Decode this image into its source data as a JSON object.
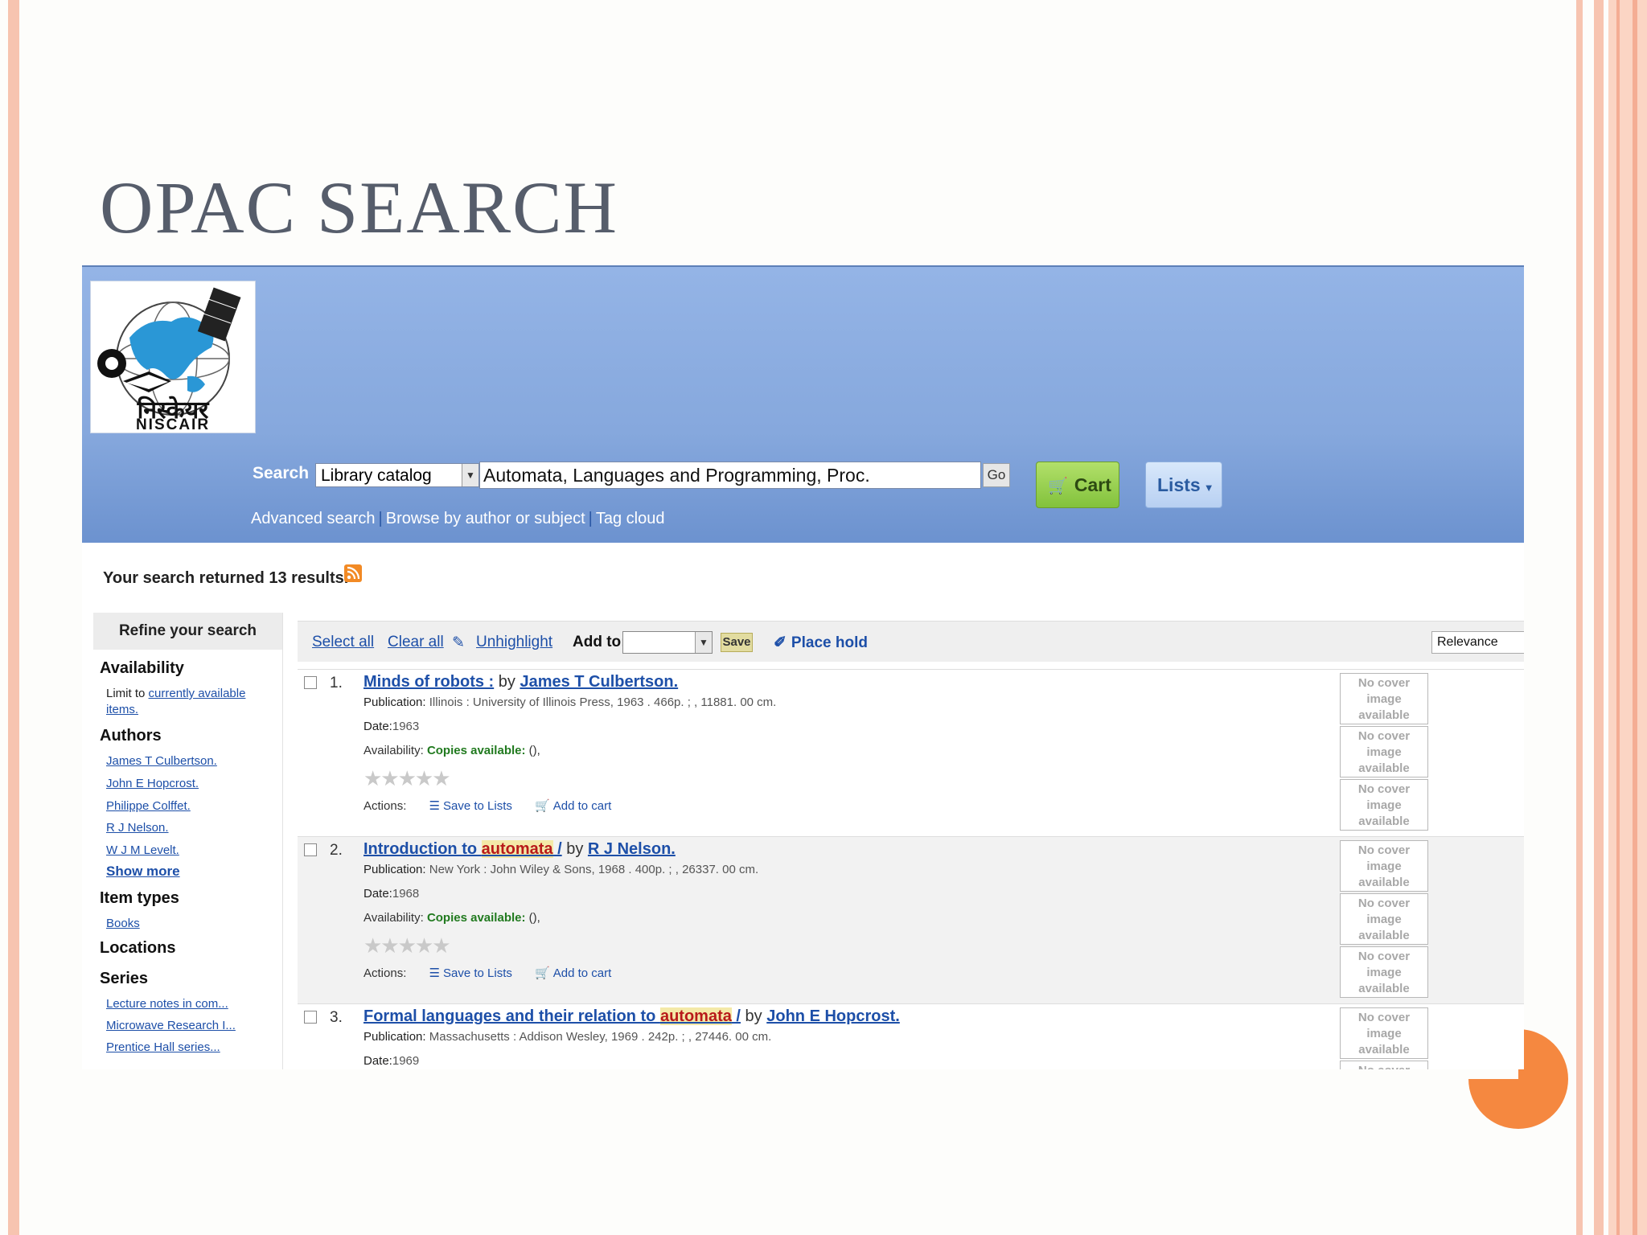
{
  "slide": {
    "title": "OPAC SEARCH"
  },
  "header": {
    "logo_text_devanagari": "निस्केयर",
    "logo_text": "NISCAIR",
    "search_label": "Search",
    "catalog_select": "Library catalog",
    "query": "Automata, Languages and Programming, Proc.",
    "go_label": "Go",
    "cart_label": "Cart",
    "lists_label": "Lists",
    "subnav": [
      "Advanced search",
      "Browse by author or subject",
      "Tag cloud"
    ]
  },
  "results_summary": "Your search returned 13 results.",
  "facets": {
    "heading": "Refine your search",
    "availability_heading": "Availability",
    "availability_prefix": "Limit to",
    "availability_link_1": "currently available",
    "availability_link_2": "items.",
    "authors_heading": "Authors",
    "authors": [
      "James T Culbertson.",
      "John E Hopcrost.",
      "Philippe Colffet.",
      "R J Nelson.",
      "W J M Levelt."
    ],
    "show_more": "Show more",
    "item_types_heading": "Item types",
    "item_types": [
      "Books"
    ],
    "locations_heading": "Locations",
    "series_heading": "Series",
    "series": [
      "Lecture notes in com...",
      "Microwave Research I...",
      "Prentice Hall series..."
    ]
  },
  "toolbar": {
    "select_all": "Select all",
    "clear_all": "Clear all",
    "unhighlight": "Unhighlight",
    "add_to": "Add to:",
    "save": "Save",
    "place_hold": "Place hold",
    "sort": "Relevance"
  },
  "result_labels": {
    "by": "by",
    "publication": "Publication:",
    "date": "Date:",
    "availability": "Availability:",
    "copies_available": "Copies available:",
    "availability_suffix": " (),",
    "actions": "Actions:",
    "save_to_lists": "Save to Lists",
    "add_to_cart": "Add to cart",
    "no_cover": [
      "No cover",
      "image",
      "available"
    ]
  },
  "results": [
    {
      "num": "1.",
      "title_pre": "Minds of robots :",
      "title_hl": "",
      "title_post": "",
      "author": "James T Culbertson.",
      "publication": "Illinois : University of Illinois Press, 1963 . 466p. ; , 11881. 00 cm.",
      "date": "1963"
    },
    {
      "num": "2.",
      "title_pre": "Introduction to ",
      "title_hl": "automata",
      "title_post": " /",
      "author": "R J Nelson.",
      "publication": "New York : John Wiley & Sons, 1968 . 400p. ; , 26337. 00 cm.",
      "date": "1968"
    },
    {
      "num": "3.",
      "title_pre": "Formal languages and their relation to ",
      "title_hl": "automata",
      "title_post": " /",
      "author": "John E Hopcrost.",
      "publication": "Massachusetts : Addison Wesley, 1969 . 242p. ; , 27446. 00 cm.",
      "date": "1969"
    }
  ],
  "colors": {
    "accent": "#f58840",
    "header_blue": "#86a8dd",
    "link": "#1d4fa8"
  }
}
